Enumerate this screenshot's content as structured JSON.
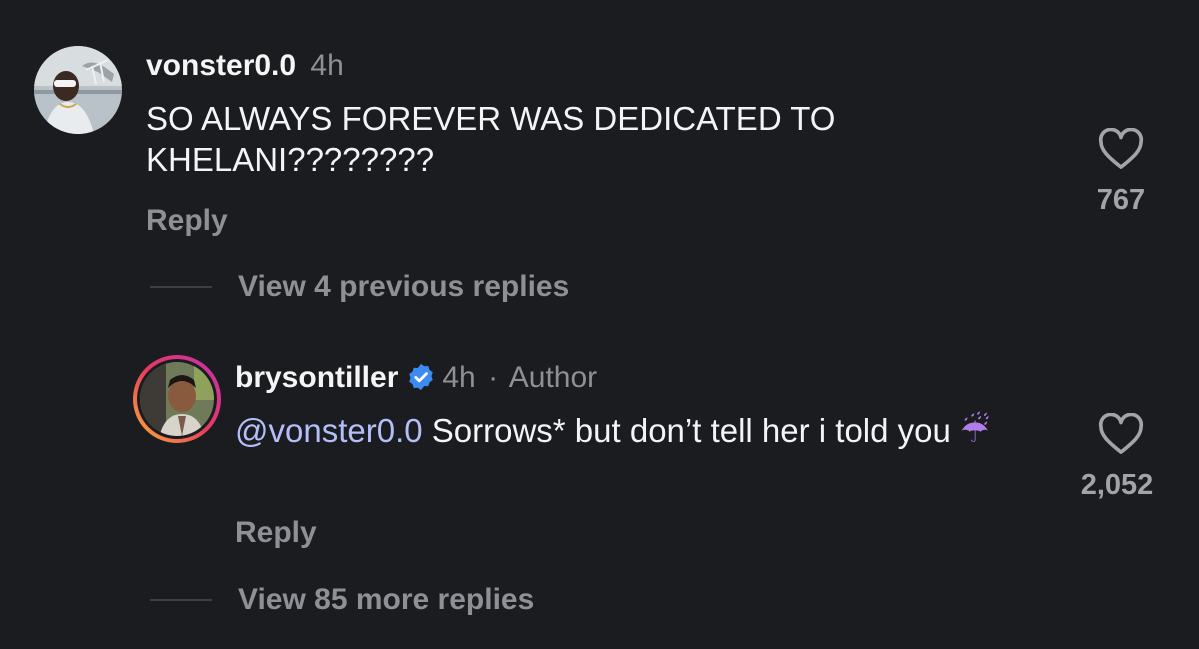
{
  "comments": [
    {
      "username": "vonster0.0",
      "time": "4h",
      "text": "SO ALWAYS FOREVER WAS DEDICATED TO KHELANI????????",
      "reply_label": "Reply",
      "likes": "767",
      "icons": {
        "avatar": "avatar",
        "like": "heart-icon"
      }
    },
    {
      "username": "brysontiller",
      "verified": true,
      "time": "4h",
      "separator": "·",
      "tag": "Author",
      "mention": "@vonster0.0",
      "text": " Sorrows* but don’t tell her i told you ",
      "emoji": "☔",
      "reply_label": "Reply",
      "likes": "2,052",
      "icons": {
        "avatar": "story-ring-avatar",
        "verified": "verified-badge-icon",
        "like": "heart-icon",
        "emoji": "umbrella-rain-icon"
      }
    }
  ],
  "threads": {
    "previous_replies": "View 4 previous replies",
    "more_replies": "View 85 more replies"
  },
  "colors": {
    "background": "#1b1c1f",
    "text": "#f3f4f6",
    "muted": "#8e9096",
    "mention": "#b4bef8",
    "verified": "#3b8bf3"
  }
}
